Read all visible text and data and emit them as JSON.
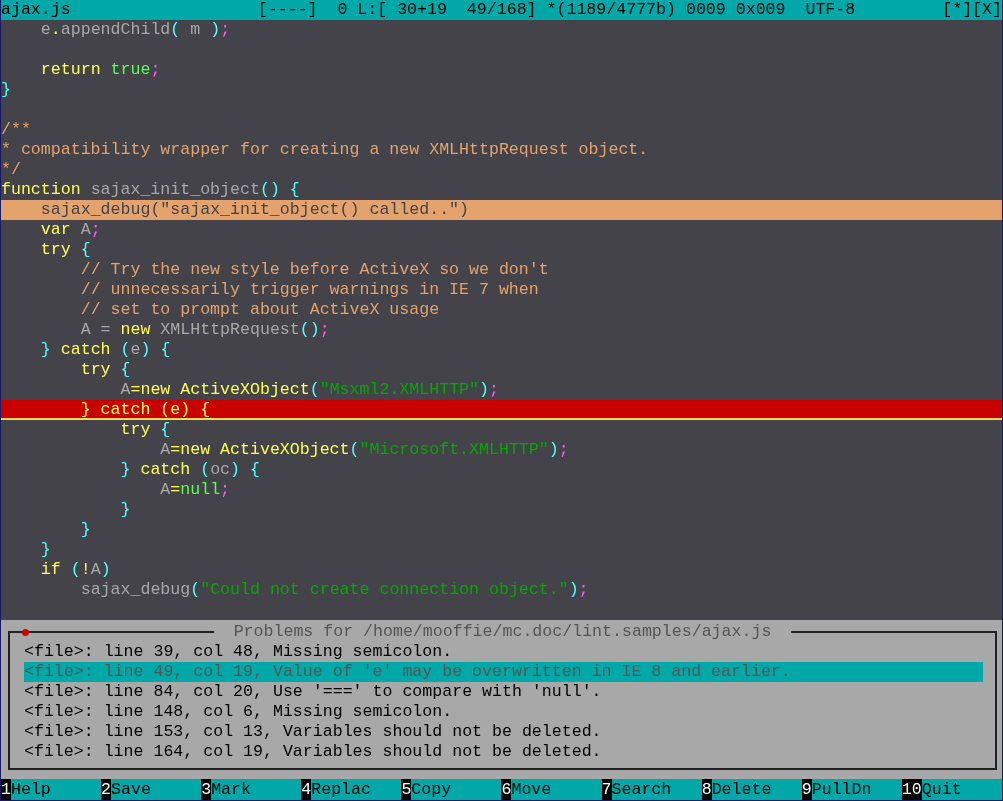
{
  "status_line": {
    "filename": "ajax.js",
    "info": "[----]  0 L:[ 30+19  49/168] *(1189/4777b) 0009 0x009  UTF-8",
    "controls": "[*][X]"
  },
  "lines": [
    {
      "kind": "normal",
      "tokens": [
        {
          "text": "    e",
          "kind": "identifier"
        },
        {
          "text": ".",
          "kind": "keyword"
        },
        {
          "text": "appendChild",
          "kind": "identifier"
        },
        {
          "text": "(",
          "kind": "bracket"
        },
        {
          "text": " m ",
          "kind": "identifier"
        },
        {
          "text": ")",
          "kind": "bracket"
        },
        {
          "text": ";",
          "kind": "semicolon"
        }
      ]
    },
    {
      "kind": "blank"
    },
    {
      "kind": "normal",
      "tokens": [
        {
          "text": "    return ",
          "kind": "keyword"
        },
        {
          "text": "true",
          "kind": "literal"
        },
        {
          "text": ";",
          "kind": "semicolon"
        }
      ]
    },
    {
      "kind": "normal",
      "tokens": [
        {
          "text": "}",
          "kind": "bracket"
        }
      ]
    },
    {
      "kind": "blank"
    },
    {
      "kind": "normal",
      "tokens": [
        {
          "text": "/**",
          "kind": "comment"
        }
      ]
    },
    {
      "kind": "normal",
      "tokens": [
        {
          "text": "* compatibility wrapper for creating a new XMLHttpRequest object.",
          "kind": "comment"
        }
      ]
    },
    {
      "kind": "normal",
      "tokens": [
        {
          "text": "*/",
          "kind": "comment"
        }
      ]
    },
    {
      "kind": "normal",
      "tokens": [
        {
          "text": "function ",
          "kind": "keyword"
        },
        {
          "text": "sajax_init_object",
          "kind": "identifier"
        },
        {
          "text": "()",
          "kind": "bracket"
        },
        {
          "text": " {",
          "kind": "bracket"
        }
      ]
    },
    {
      "kind": "cursor",
      "tokens": [
        {
          "text": "    sajax_debug(\"sajax_init_object() called..\")",
          "kind": "identifier"
        }
      ]
    },
    {
      "kind": "normal",
      "tokens": [
        {
          "text": "    var ",
          "kind": "keyword"
        },
        {
          "text": "A",
          "kind": "identifier"
        },
        {
          "text": ";",
          "kind": "semicolon"
        }
      ]
    },
    {
      "kind": "normal",
      "tokens": [
        {
          "text": "    try ",
          "kind": "keyword"
        },
        {
          "text": "{",
          "kind": "bracket"
        }
      ]
    },
    {
      "kind": "normal",
      "tokens": [
        {
          "text": "        // Try the new style before ActiveX so we don't",
          "kind": "comment"
        }
      ]
    },
    {
      "kind": "normal",
      "tokens": [
        {
          "text": "        // unnecessarily trigger warnings in IE 7 when",
          "kind": "comment"
        }
      ]
    },
    {
      "kind": "normal",
      "tokens": [
        {
          "text": "        // set to prompt about ActiveX usage",
          "kind": "comment"
        }
      ]
    },
    {
      "kind": "normal",
      "tokens": [
        {
          "text": "        A = ",
          "kind": "identifier"
        },
        {
          "text": "new ",
          "kind": "keyword"
        },
        {
          "text": "XMLHttpRequest",
          "kind": "identifier"
        },
        {
          "text": "()",
          "kind": "bracket"
        },
        {
          "text": ";",
          "kind": "semicolon"
        }
      ]
    },
    {
      "kind": "normal",
      "tokens": [
        {
          "text": "    }",
          "kind": "bracket"
        },
        {
          "text": " catch ",
          "kind": "keyword"
        },
        {
          "text": "(",
          "kind": "bracket"
        },
        {
          "text": "e",
          "kind": "identifier"
        },
        {
          "text": ")",
          "kind": "bracket"
        },
        {
          "text": " {",
          "kind": "bracket"
        }
      ]
    },
    {
      "kind": "normal",
      "tokens": [
        {
          "text": "        try ",
          "kind": "keyword"
        },
        {
          "text": "{",
          "kind": "bracket"
        }
      ]
    },
    {
      "kind": "normal",
      "tokens": [
        {
          "text": "            A",
          "kind": "identifier"
        },
        {
          "text": "=new ActiveXObject",
          "kind": "keyword"
        },
        {
          "text": "(",
          "kind": "bracket"
        },
        {
          "text": "\"Msxml2.XMLHTTP\"",
          "kind": "string"
        },
        {
          "text": ")",
          "kind": "bracket"
        },
        {
          "text": ";",
          "kind": "semicolon"
        }
      ]
    },
    {
      "kind": "error",
      "tokens": [
        {
          "text": "        } catch (e) {",
          "kind": "keyword"
        }
      ]
    },
    {
      "kind": "normal",
      "tokens": [
        {
          "text": "            try ",
          "kind": "keyword"
        },
        {
          "text": "{",
          "kind": "bracket"
        }
      ]
    },
    {
      "kind": "normal",
      "tokens": [
        {
          "text": "                A",
          "kind": "identifier"
        },
        {
          "text": "=new ActiveXObject",
          "kind": "keyword"
        },
        {
          "text": "(",
          "kind": "bracket"
        },
        {
          "text": "\"Microsoft.XMLHTTP\"",
          "kind": "string"
        },
        {
          "text": ")",
          "kind": "bracket"
        },
        {
          "text": ";",
          "kind": "semicolon"
        }
      ]
    },
    {
      "kind": "normal",
      "tokens": [
        {
          "text": "            }",
          "kind": "bracket"
        },
        {
          "text": " catch ",
          "kind": "keyword"
        },
        {
          "text": "(",
          "kind": "bracket"
        },
        {
          "text": "oc",
          "kind": "identifier"
        },
        {
          "text": ")",
          "kind": "bracket"
        },
        {
          "text": " {",
          "kind": "bracket"
        }
      ]
    },
    {
      "kind": "normal",
      "tokens": [
        {
          "text": "                A",
          "kind": "identifier"
        },
        {
          "text": "=",
          "kind": "keyword"
        },
        {
          "text": "null",
          "kind": "literal"
        },
        {
          "text": ";",
          "kind": "semicolon"
        }
      ]
    },
    {
      "kind": "normal",
      "tokens": [
        {
          "text": "            }",
          "kind": "bracket"
        }
      ]
    },
    {
      "kind": "normal",
      "tokens": [
        {
          "text": "        }",
          "kind": "bracket"
        }
      ]
    },
    {
      "kind": "normal",
      "tokens": [
        {
          "text": "    }",
          "kind": "bracket"
        }
      ]
    },
    {
      "kind": "normal",
      "tokens": [
        {
          "text": "    if ",
          "kind": "keyword"
        },
        {
          "text": "(",
          "kind": "bracket"
        },
        {
          "text": "!",
          "kind": "keyword"
        },
        {
          "text": "A",
          "kind": "identifier"
        },
        {
          "text": ")",
          "kind": "bracket"
        }
      ]
    },
    {
      "kind": "normal",
      "tokens": [
        {
          "text": "        sajax_debug",
          "kind": "identifier"
        },
        {
          "text": "(",
          "kind": "bracket"
        },
        {
          "text": "\"Could not create connection object.\"",
          "kind": "string"
        },
        {
          "text": ")",
          "kind": "bracket"
        },
        {
          "text": ";",
          "kind": "semicolon"
        }
      ]
    },
    {
      "kind": "blank"
    }
  ],
  "problems": {
    "title": "Problems for /home/mooffie/mc.doc/lint.samples/ajax.js",
    "items": [
      {
        "text": "<file>: line 39, col 48, Missing semicolon.",
        "selected": false
      },
      {
        "text": "<file>: line 49, col 19, Value of 'e' may be overwritten in IE 8 and earlier.",
        "selected": true
      },
      {
        "text": "<file>: line 84, col 20, Use '===' to compare with 'null'.",
        "selected": false
      },
      {
        "text": "<file>: line 148, col 6, Missing semicolon.",
        "selected": false
      },
      {
        "text": "<file>: line 153, col 13, Variables should not be deleted.",
        "selected": false
      },
      {
        "text": "<file>: line 164, col 19, Variables should not be deleted.",
        "selected": false
      }
    ]
  },
  "function_keys": [
    {
      "key": "1",
      "label": "Help"
    },
    {
      "key": "2",
      "label": "Save"
    },
    {
      "key": "3",
      "label": "Mark"
    },
    {
      "key": "4",
      "label": "Replac"
    },
    {
      "key": "5",
      "label": "Copy"
    },
    {
      "key": "6",
      "label": "Move"
    },
    {
      "key": "7",
      "label": "Search"
    },
    {
      "key": "8",
      "label": "Delete"
    },
    {
      "key": "9",
      "label": "PullDn"
    },
    {
      "key": "10",
      "label": "Quit"
    }
  ]
}
